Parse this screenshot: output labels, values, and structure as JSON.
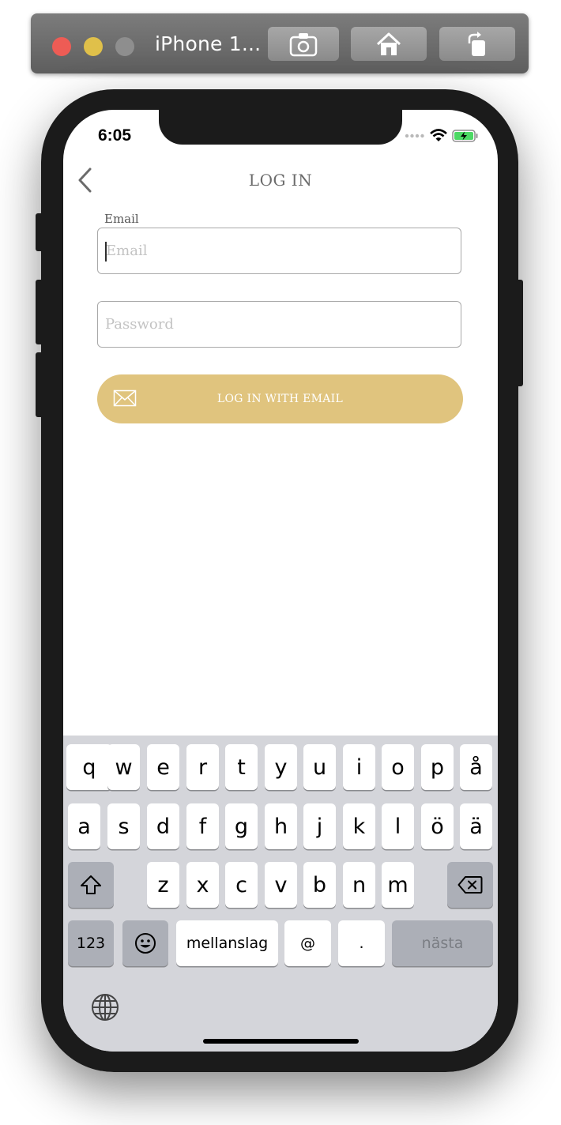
{
  "simulator": {
    "title": "iPhone 1...",
    "buttons": [
      "screenshot-icon",
      "home-icon",
      "rotate-icon"
    ]
  },
  "status_bar": {
    "time": "6:05"
  },
  "nav": {
    "title": "LOG IN",
    "back_icon": "chevron-left-icon"
  },
  "form": {
    "email_label": "Email",
    "email_placeholder": "Email",
    "password_placeholder": "Password",
    "login_button_label": "LOG IN WITH EMAIL",
    "login_button_icon": "envelope-icon",
    "login_button_color": "#e0c47e"
  },
  "keyboard": {
    "row1": [
      "q",
      "w",
      "e",
      "r",
      "t",
      "y",
      "u",
      "i",
      "o",
      "p",
      "å"
    ],
    "row2": [
      "a",
      "s",
      "d",
      "f",
      "g",
      "h",
      "j",
      "k",
      "l",
      "ö",
      "ä"
    ],
    "row3": [
      "z",
      "x",
      "c",
      "v",
      "b",
      "n",
      "m"
    ],
    "numbers_key": "123",
    "space_key": "mellanslag",
    "at_key": "@",
    "dot_key": ".",
    "next_key": "nästa"
  }
}
